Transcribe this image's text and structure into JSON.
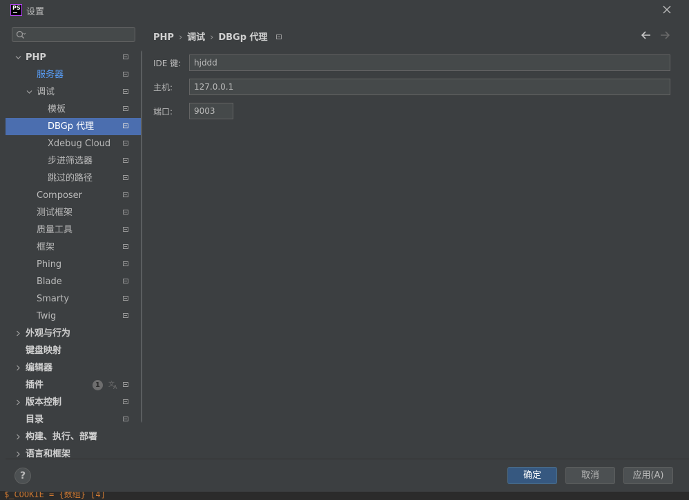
{
  "window": {
    "title": "设置",
    "app_icon_text": "PS"
  },
  "search": {
    "placeholder": "",
    "value": ""
  },
  "tree": [
    {
      "label": "PHP",
      "level": 0,
      "expand": "open",
      "style": "bold",
      "project": true
    },
    {
      "label": "服务器",
      "level": 1,
      "expand": "none",
      "style": "link",
      "project": true
    },
    {
      "label": "调试",
      "level": 1,
      "expand": "open",
      "style": "normal",
      "project": true
    },
    {
      "label": "模板",
      "level": 2,
      "expand": "none",
      "style": "normal",
      "project": true
    },
    {
      "label": "DBGp 代理",
      "level": 2,
      "expand": "none",
      "style": "normal",
      "project": true,
      "selected": true
    },
    {
      "label": "Xdebug Cloud",
      "level": 2,
      "expand": "none",
      "style": "normal",
      "project": true
    },
    {
      "label": "步进筛选器",
      "level": 2,
      "expand": "none",
      "style": "normal",
      "project": true
    },
    {
      "label": "跳过的路径",
      "level": 2,
      "expand": "none",
      "style": "normal",
      "project": true
    },
    {
      "label": "Composer",
      "level": 1,
      "expand": "none",
      "style": "normal",
      "project": true
    },
    {
      "label": "测试框架",
      "level": 1,
      "expand": "none",
      "style": "normal",
      "project": true
    },
    {
      "label": "质量工具",
      "level": 1,
      "expand": "none",
      "style": "normal",
      "project": true
    },
    {
      "label": "框架",
      "level": 1,
      "expand": "none",
      "style": "normal",
      "project": true
    },
    {
      "label": "Phing",
      "level": 1,
      "expand": "none",
      "style": "normal",
      "project": true
    },
    {
      "label": "Blade",
      "level": 1,
      "expand": "none",
      "style": "normal",
      "project": true
    },
    {
      "label": "Smarty",
      "level": 1,
      "expand": "none",
      "style": "normal",
      "project": true
    },
    {
      "label": "Twig",
      "level": 1,
      "expand": "none",
      "style": "normal",
      "project": true
    },
    {
      "label": "外观与行为",
      "level": 0,
      "expand": "closed",
      "style": "bold",
      "project": false
    },
    {
      "label": "键盘映射",
      "level": 0,
      "expand": "none",
      "style": "bold",
      "project": false
    },
    {
      "label": "编辑器",
      "level": 0,
      "expand": "closed",
      "style": "bold",
      "project": false
    },
    {
      "label": "插件",
      "level": 0,
      "expand": "none",
      "style": "bold",
      "project": true,
      "badge": "1",
      "translate_icon": true
    },
    {
      "label": "版本控制",
      "level": 0,
      "expand": "closed",
      "style": "bold",
      "project": true
    },
    {
      "label": "目录",
      "level": 0,
      "expand": "none",
      "style": "bold",
      "project": true
    },
    {
      "label": "构建、执行、部署",
      "level": 0,
      "expand": "closed",
      "style": "bold",
      "project": false
    },
    {
      "label": "语言和框架",
      "level": 0,
      "expand": "closed",
      "style": "bold",
      "project": false
    }
  ],
  "breadcrumb": {
    "items": [
      "PHP",
      "调试",
      "DBGp 代理"
    ],
    "separator": "›"
  },
  "form": {
    "ide_key": {
      "label": "IDE 键:",
      "value": "hjddd"
    },
    "host": {
      "label": "主机:",
      "value": "127.0.0.1"
    },
    "port": {
      "label": "端口:",
      "value": "9003"
    }
  },
  "footer": {
    "help": "?",
    "ok": "确定",
    "cancel": "取消",
    "apply": "应用(A)"
  },
  "background": {
    "bottom_code": "$_COOKIE = {数组} [4]"
  },
  "colors": {
    "accent": "#4b6eaf",
    "link": "#589df6",
    "primary_button": "#365880",
    "background": "#3c3f41"
  }
}
